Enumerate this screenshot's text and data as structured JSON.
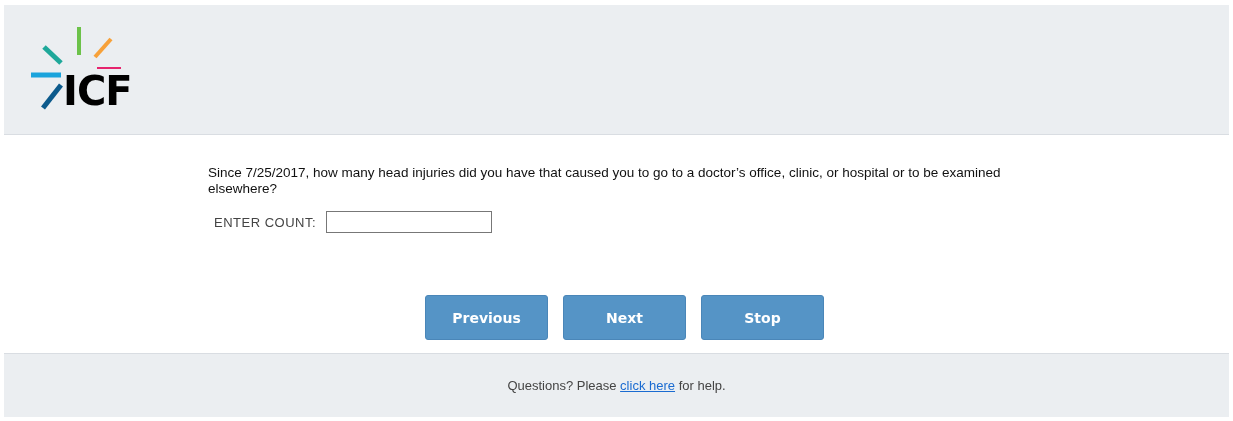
{
  "header": {
    "logo_text": "ICF"
  },
  "question": {
    "text": "Since 7/25/2017, how many head injuries did you have that caused you to go to a doctor’s office, clinic, or hospital or to be examined elsewhere?",
    "field_label": "ENTER COUNT:"
  },
  "buttons": [
    "Previous",
    "Next",
    "Stop"
  ],
  "footer": {
    "text_before": "Questions? Please",
    "link": "click here",
    "text_after": "for help."
  }
}
